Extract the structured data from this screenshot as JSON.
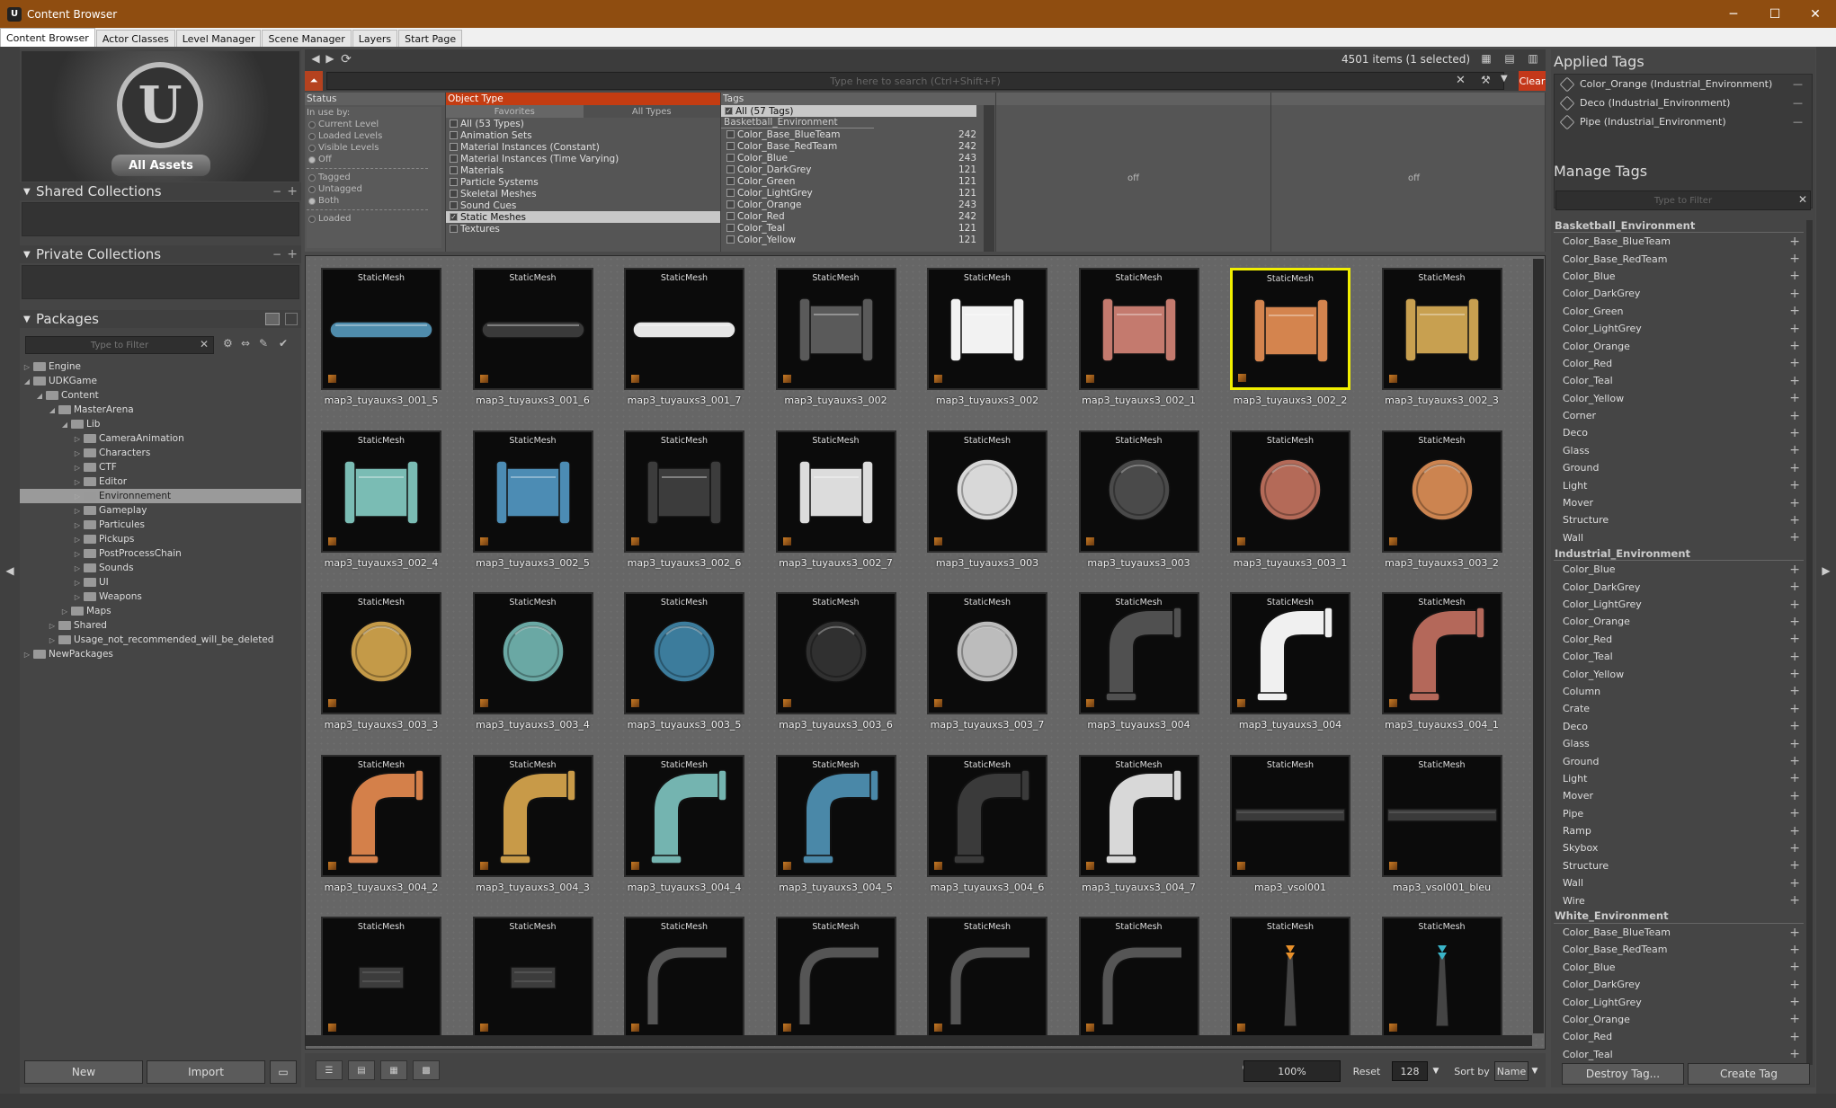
{
  "window": {
    "title": "Content Browser",
    "minimize": "─",
    "maximize": "☐",
    "close": "✕"
  },
  "tabs": [
    "Content Browser",
    "Actor Classes",
    "Level Manager",
    "Scene Manager",
    "Layers",
    "Start Page"
  ],
  "left": {
    "all_assets": "All Assets",
    "shared_collections": "Shared Collections",
    "private_collections": "Private Collections",
    "packages": "Packages",
    "filter_placeholder": "Type to Filter",
    "tree": [
      {
        "label": "Engine",
        "depth": 0,
        "arrow": "▷"
      },
      {
        "label": "UDKGame",
        "depth": 0,
        "arrow": "◢"
      },
      {
        "label": "Content",
        "depth": 1,
        "arrow": "◢"
      },
      {
        "label": "MasterArena",
        "depth": 2,
        "arrow": "◢"
      },
      {
        "label": "Lib",
        "depth": 3,
        "arrow": "◢"
      },
      {
        "label": "CameraAnimation",
        "depth": 4,
        "arrow": "▷"
      },
      {
        "label": "Characters",
        "depth": 4,
        "arrow": "▷"
      },
      {
        "label": "CTF",
        "depth": 4,
        "arrow": "▷"
      },
      {
        "label": "Editor",
        "depth": 4,
        "arrow": "▷"
      },
      {
        "label": "Environnement",
        "depth": 4,
        "arrow": "▷",
        "selected": true
      },
      {
        "label": "Gameplay",
        "depth": 4,
        "arrow": "▷"
      },
      {
        "label": "Particules",
        "depth": 4,
        "arrow": "▷"
      },
      {
        "label": "Pickups",
        "depth": 4,
        "arrow": "▷"
      },
      {
        "label": "PostProcessChain",
        "depth": 4,
        "arrow": "▷"
      },
      {
        "label": "Sounds",
        "depth": 4,
        "arrow": "▷"
      },
      {
        "label": "UI",
        "depth": 4,
        "arrow": "▷"
      },
      {
        "label": "Weapons",
        "depth": 4,
        "arrow": "▷"
      },
      {
        "label": "Maps",
        "depth": 3,
        "arrow": "▷"
      },
      {
        "label": "Shared",
        "depth": 2,
        "arrow": "▷"
      },
      {
        "label": "Usage_not_recommended_will_be_deleted",
        "depth": 2,
        "arrow": "▷"
      },
      {
        "label": "NewPackages",
        "depth": 0,
        "arrow": "▷"
      }
    ],
    "new_button": "New",
    "import_button": "Import"
  },
  "toolbar": {
    "count": "4501 items (1 selected)"
  },
  "search": {
    "placeholder": "Type here to search   (Ctrl+Shift+F)",
    "clear": "Clear"
  },
  "filters": {
    "status_header": "Status",
    "in_use_by": "In use by:",
    "status_options": [
      "Current Level",
      "Loaded Levels",
      "Visible Levels",
      "Off"
    ],
    "tag_options": [
      "Tagged",
      "Untagged",
      "Both"
    ],
    "loaded": "Loaded",
    "object_type_header": "Object Type",
    "favorites_tab": "Favorites",
    "all_types_tab": "All Types",
    "types": [
      {
        "label": "All (53 Types)",
        "checked": false
      },
      {
        "label": "Animation Sets",
        "checked": false
      },
      {
        "label": "Material Instances (Constant)",
        "checked": false
      },
      {
        "label": "Material Instances (Time Varying)",
        "checked": false
      },
      {
        "label": "Materials",
        "checked": false
      },
      {
        "label": "Particle Systems",
        "checked": false
      },
      {
        "label": "Skeletal Meshes",
        "checked": false
      },
      {
        "label": "Sound Cues",
        "checked": false
      },
      {
        "label": "Static Meshes",
        "checked": true
      },
      {
        "label": "Textures",
        "checked": false
      }
    ],
    "tags_header": "Tags",
    "all_tags": "All (57 Tags)",
    "tag_group": "Basketball_Environment",
    "tags": [
      {
        "label": "Color_Base_BlueTeam",
        "count": "242"
      },
      {
        "label": "Color_Base_RedTeam",
        "count": "242"
      },
      {
        "label": "Color_Blue",
        "count": "243"
      },
      {
        "label": "Color_DarkGrey",
        "count": "121"
      },
      {
        "label": "Color_Green",
        "count": "121"
      },
      {
        "label": "Color_LightGrey",
        "count": "121"
      },
      {
        "label": "Color_Orange",
        "count": "243"
      },
      {
        "label": "Color_Red",
        "count": "242"
      },
      {
        "label": "Color_Teal",
        "count": "121"
      },
      {
        "label": "Color_Yellow",
        "count": "121"
      }
    ],
    "off1": "off",
    "off2": "off"
  },
  "assets": {
    "type_label": "StaticMesh",
    "items": [
      {
        "name": "map3_tuyauxs3_001_5",
        "shape": "pipe",
        "color": "#4f8cac"
      },
      {
        "name": "map3_tuyauxs3_001_6",
        "shape": "pipe",
        "color": "#3a3a3a"
      },
      {
        "name": "map3_tuyauxs3_001_7",
        "shape": "pipe",
        "color": "#e6e6e6"
      },
      {
        "name": "map3_tuyauxs3_002",
        "shape": "coupler",
        "color": "#5a5a5a"
      },
      {
        "name": "map3_tuyauxs3_002",
        "shape": "coupler",
        "color": "#f2f2f2"
      },
      {
        "name": "map3_tuyauxs3_002_1",
        "shape": "coupler",
        "color": "#c47a6e"
      },
      {
        "name": "map3_tuyauxs3_002_2",
        "shape": "coupler",
        "color": "#d4844e",
        "selected": true
      },
      {
        "name": "map3_tuyauxs3_002_3",
        "shape": "coupler",
        "color": "#c8a050"
      },
      {
        "name": "map3_tuyauxs3_002_4",
        "shape": "coupler",
        "color": "#7abcb4"
      },
      {
        "name": "map3_tuyauxs3_002_5",
        "shape": "coupler",
        "color": "#4c8cb4"
      },
      {
        "name": "map3_tuyauxs3_002_6",
        "shape": "coupler",
        "color": "#3c3c3c"
      },
      {
        "name": "map3_tuyauxs3_002_7",
        "shape": "coupler",
        "color": "#dcdcdc"
      },
      {
        "name": "map3_tuyauxs3_003",
        "shape": "plate",
        "color": "#d8d8d8"
      },
      {
        "name": "map3_tuyauxs3_003",
        "shape": "plate",
        "color": "#4a4a4a"
      },
      {
        "name": "map3_tuyauxs3_003_1",
        "shape": "plate",
        "color": "#b46a58"
      },
      {
        "name": "map3_tuyauxs3_003_2",
        "shape": "plate",
        "color": "#cc8450"
      },
      {
        "name": "map3_tuyauxs3_003_3",
        "shape": "plate",
        "color": "#c49a48"
      },
      {
        "name": "map3_tuyauxs3_003_4",
        "shape": "plate",
        "color": "#6aa8a4"
      },
      {
        "name": "map3_tuyauxs3_003_5",
        "shape": "plate",
        "color": "#3c7c9c"
      },
      {
        "name": "map3_tuyauxs3_003_6",
        "shape": "plate",
        "color": "#303030"
      },
      {
        "name": "map3_tuyauxs3_003_7",
        "shape": "plate",
        "color": "#bcbcbc"
      },
      {
        "name": "map3_tuyauxs3_004",
        "shape": "elbow",
        "color": "#505050"
      },
      {
        "name": "map3_tuyauxs3_004",
        "shape": "elbow",
        "color": "#f0f0f0"
      },
      {
        "name": "map3_tuyauxs3_004_1",
        "shape": "elbow",
        "color": "#b4685a"
      },
      {
        "name": "map3_tuyauxs3_004_2",
        "shape": "elbow",
        "color": "#d4804a"
      },
      {
        "name": "map3_tuyauxs3_004_3",
        "shape": "elbow",
        "color": "#c89a48"
      },
      {
        "name": "map3_tuyauxs3_004_4",
        "shape": "elbow",
        "color": "#74b4b0"
      },
      {
        "name": "map3_tuyauxs3_004_5",
        "shape": "elbow",
        "color": "#4a88a8"
      },
      {
        "name": "map3_tuyauxs3_004_6",
        "shape": "elbow",
        "color": "#3a3a3a"
      },
      {
        "name": "map3_tuyauxs3_004_7",
        "shape": "elbow",
        "color": "#d8d8d8"
      },
      {
        "name": "map3_vsol001",
        "shape": "bar",
        "color": "#3a3a3a"
      },
      {
        "name": "map3_vsol001_bleu",
        "shape": "bar",
        "color": "#3a3a3a"
      },
      {
        "name": "",
        "shape": "brick",
        "color": "#3c3c3c"
      },
      {
        "name": "",
        "shape": "brick",
        "color": "#3c3c3c"
      },
      {
        "name": "",
        "shape": "curve",
        "color": "#3a3a3a"
      },
      {
        "name": "",
        "shape": "curve",
        "color": "#3a3a3a"
      },
      {
        "name": "",
        "shape": "curve",
        "color": "#3a3a3a"
      },
      {
        "name": "",
        "shape": "curve",
        "color": "#3a3a3a"
      },
      {
        "name": "",
        "shape": "tower",
        "color": "#e8902a"
      },
      {
        "name": "",
        "shape": "tower",
        "color": "#3ab4c8"
      }
    ]
  },
  "bottom": {
    "zoom": "100%",
    "reset": "Reset",
    "size": "128",
    "sort_by": "Sort by",
    "sort": "Name"
  },
  "right": {
    "applied_tags": "Applied Tags",
    "applied": [
      "Color_Orange (Industrial_Environment)",
      "Deco (Industrial_Environment)",
      "Pipe (Industrial_Environment)"
    ],
    "manage_tags": "Manage Tags",
    "filter_placeholder": "Type to Filter",
    "groups": [
      {
        "name": "Basketball_Environment",
        "tags": [
          "Color_Base_BlueTeam",
          "Color_Base_RedTeam",
          "Color_Blue",
          "Color_DarkGrey",
          "Color_Green",
          "Color_LightGrey",
          "Color_Orange",
          "Color_Red",
          "Color_Teal",
          "Color_Yellow",
          "Corner",
          "Deco",
          "Glass",
          "Ground",
          "Light",
          "Mover",
          "Structure",
          "Wall"
        ]
      },
      {
        "name": "Industrial_Environment",
        "tags": [
          "Color_Blue",
          "Color_DarkGrey",
          "Color_LightGrey",
          "Color_Orange",
          "Color_Red",
          "Color_Teal",
          "Color_Yellow",
          "Column",
          "Crate",
          "Deco",
          "Glass",
          "Ground",
          "Light",
          "Mover",
          "Pipe",
          "Ramp",
          "Skybox",
          "Structure",
          "Wall",
          "Wire"
        ]
      },
      {
        "name": "White_Environment",
        "tags": [
          "Color_Base_BlueTeam",
          "Color_Base_RedTeam",
          "Color_Blue",
          "Color_DarkGrey",
          "Color_LightGrey",
          "Color_Orange",
          "Color_Red",
          "Color_Teal"
        ]
      }
    ],
    "destroy_tag": "Destroy Tag...",
    "create_tag": "Create Tag"
  }
}
